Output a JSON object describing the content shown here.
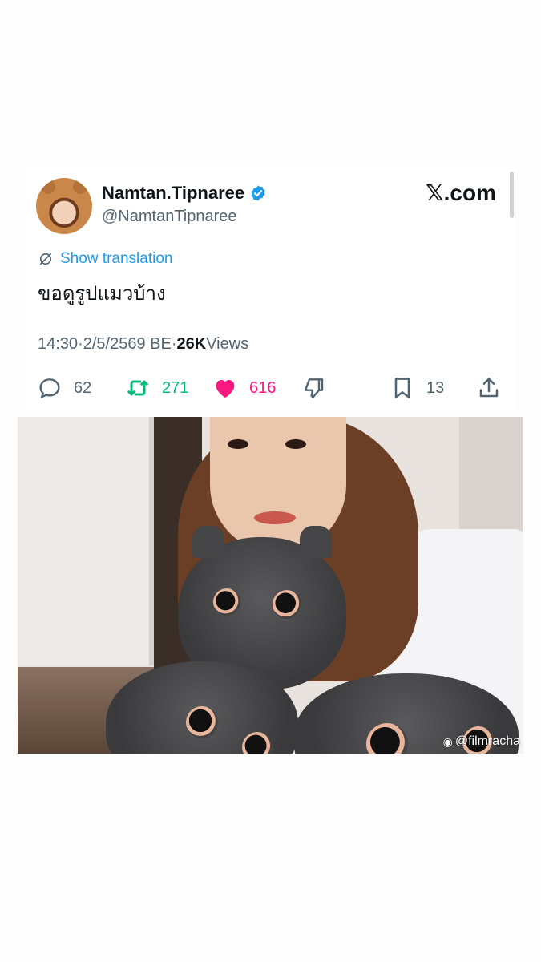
{
  "tweet": {
    "display_name": "Namtan.Tipnaree",
    "handle": "@NamtanTipnaree",
    "verified": true,
    "brand": "𝕏.com",
    "translate_label": "Show translation",
    "text": "ขอดูรูปแมวบ้าง",
    "time": "14:30",
    "separator": " · ",
    "date": "2/5/2569 BE",
    "views_count": "26K",
    "views_label": " Views",
    "stats": {
      "replies": "62",
      "retweets": "271",
      "likes": "616",
      "bookmarks": "13"
    },
    "colors": {
      "accent": "#1d9bf0",
      "retweet": "#00ba7c",
      "like": "#f91880",
      "muted": "#536471"
    }
  },
  "photo": {
    "watermark_icon": "weibo-icon",
    "watermark_text": "@filmracha"
  },
  "icons": {
    "reply": "reply-icon",
    "retweet": "retweet-icon",
    "like": "heart-icon",
    "dislike": "dislike-icon",
    "bookmark": "bookmark-icon",
    "share": "share-icon",
    "verified": "verified-badge-icon",
    "translate": "translate-icon"
  }
}
